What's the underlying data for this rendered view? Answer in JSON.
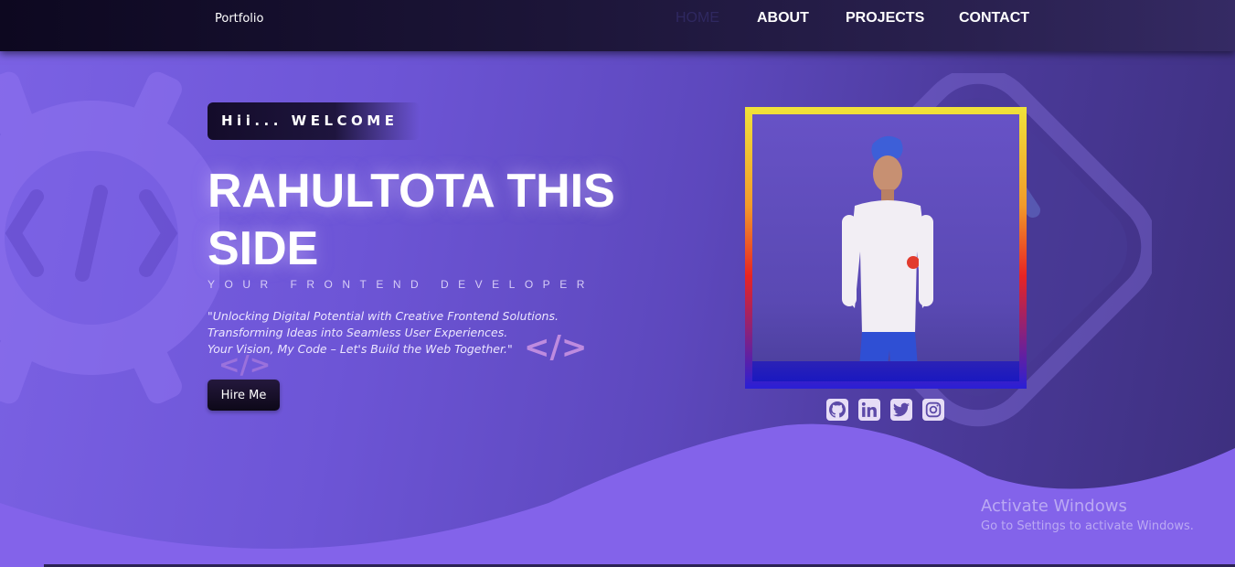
{
  "navbar": {
    "brand": "Portfolio",
    "links": [
      "HOME",
      "ABOUT",
      "PROJECTS",
      "CONTACT"
    ],
    "active": "HOME"
  },
  "hero": {
    "welcome": "Hii... WELCOME",
    "title": "RAHULTOTA THIS SIDE",
    "subtitle": "YOUR FRONTEND DEVELOPER",
    "tagline": [
      "\"Unlocking Digital Potential with Creative Frontend Solutions.",
      "Transforming Ideas into Seamless User Experiences.",
      "Your Vision, My Code – Let's Build the Web Together.\""
    ],
    "hire_label": "Hire Me",
    "code_glyph": "</>"
  },
  "profile_photo": {
    "subject": "profile-photo"
  },
  "socials": [
    {
      "name": "github",
      "icon": "github-icon"
    },
    {
      "name": "linkedin",
      "icon": "linkedin-icon"
    },
    {
      "name": "twitter",
      "icon": "twitter-icon"
    },
    {
      "name": "instagram",
      "icon": "instagram-icon"
    }
  ],
  "watermark": {
    "line1": "Activate Windows",
    "line2": "Go to Settings to activate Windows."
  },
  "colors": {
    "accent": "#7b62e4",
    "nav_bg": "#1c1538",
    "wave": "#8363ea"
  }
}
